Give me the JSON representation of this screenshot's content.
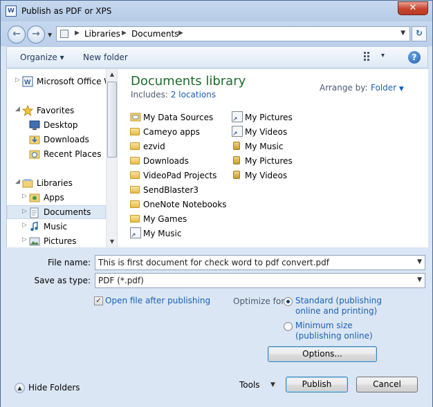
{
  "window": {
    "title": "Publish as PDF or XPS",
    "close_glyph": "✕"
  },
  "address": {
    "segments": [
      "Libraries",
      "Documents"
    ],
    "arrow_glyph": "▶"
  },
  "toolbar": {
    "organize": "Organize ▾",
    "new_folder": "New folder",
    "views_glyph": "▾",
    "help_glyph": "?"
  },
  "nav": {
    "items": [
      {
        "label": "Microsoft Office W",
        "icon": "word-icon"
      },
      {
        "label": "Favorites",
        "icon": "star-icon"
      },
      {
        "label": "Desktop",
        "icon": "desktop-icon"
      },
      {
        "label": "Downloads",
        "icon": "downloads-folder-icon"
      },
      {
        "label": "Recent Places",
        "icon": "recent-places-icon"
      },
      {
        "label": "Libraries",
        "icon": "libraries-icon"
      },
      {
        "label": "Apps",
        "icon": "apps-library-icon"
      },
      {
        "label": "Documents",
        "icon": "documents-library-icon"
      },
      {
        "label": "Music",
        "icon": "music-library-icon"
      },
      {
        "label": "Pictures",
        "icon": "pictures-library-icon"
      }
    ]
  },
  "library": {
    "title": "Documents library",
    "includes_label": "Includes:",
    "includes_link": "2 locations",
    "arrange_label": "Arrange by:",
    "arrange_value": "Folder"
  },
  "files": {
    "col1": [
      {
        "label": "My Data Sources",
        "icon": "data-sources-folder-icon"
      },
      {
        "label": "Cameyo apps",
        "icon": "folder-icon"
      },
      {
        "label": "ezvid",
        "icon": "folder-icon"
      },
      {
        "label": "Downloads",
        "icon": "folder-icon"
      },
      {
        "label": "VideoPad Projects",
        "icon": "folder-icon"
      },
      {
        "label": "SendBlaster3",
        "icon": "folder-icon"
      },
      {
        "label": "OneNote Notebooks",
        "icon": "folder-icon"
      },
      {
        "label": "My Games",
        "icon": "folder-icon"
      },
      {
        "label": "My Music",
        "icon": "shortcut-icon"
      }
    ],
    "col2": [
      {
        "label": "My Pictures",
        "icon": "shortcut-icon"
      },
      {
        "label": "My Videos",
        "icon": "shortcut-icon"
      },
      {
        "label": "My Music",
        "icon": "lock-icon"
      },
      {
        "label": "My Pictures",
        "icon": "lock-icon"
      },
      {
        "label": "My Videos",
        "icon": "lock-icon"
      }
    ]
  },
  "form": {
    "file_name_label": "File name:",
    "file_name_value": "This is first document for check word to pdf convert.pdf",
    "save_type_label": "Save as type:",
    "save_type_value": "PDF (*.pdf)",
    "open_after_label": "Open file after publishing",
    "open_after_checked": true,
    "optimize_label": "Optimize for:",
    "standard_line1": "Standard (publishing",
    "standard_line2": "online and printing)",
    "minimum_line1": "Minimum size",
    "minimum_line2": "(publishing online)",
    "options_button": "Options..."
  },
  "footer": {
    "hide_folders": "Hide Folders",
    "tools": "Tools",
    "publish": "Publish",
    "cancel": "Cancel"
  }
}
